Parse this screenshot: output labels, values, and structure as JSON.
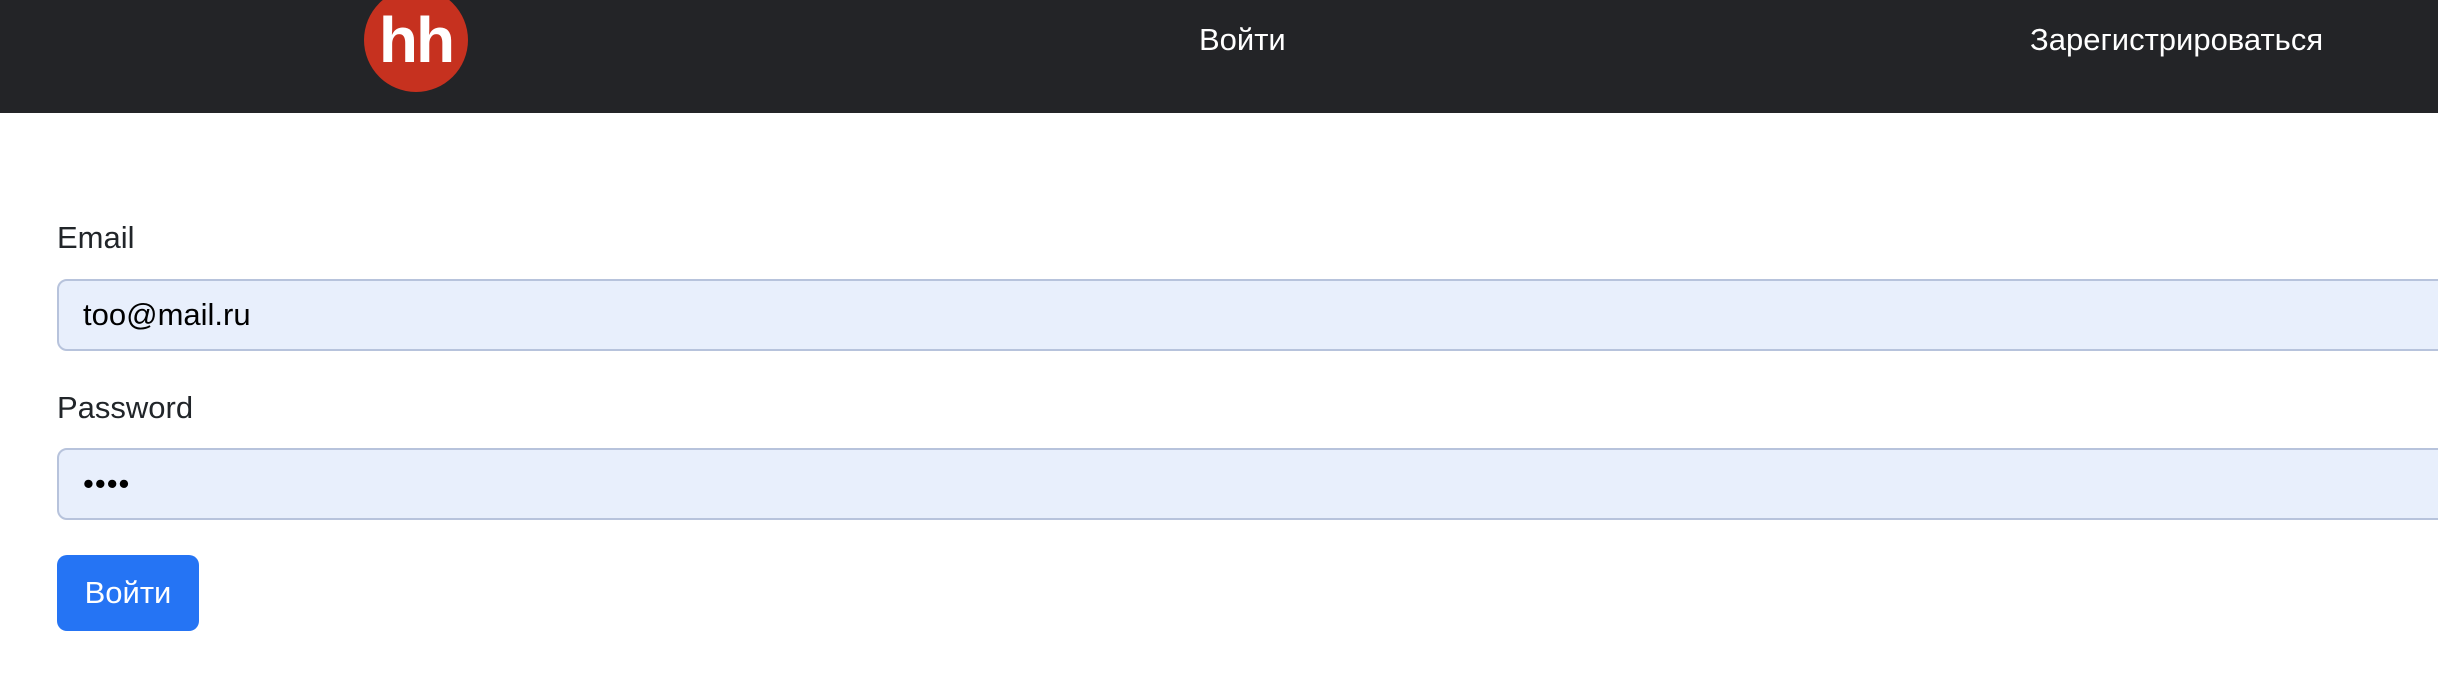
{
  "navbar": {
    "logo_text": "hh",
    "login_link": "Войти",
    "register_link": "Зарегистрироваться"
  },
  "form": {
    "email_label": "Email",
    "email_value": "too@mail.ru",
    "password_label": "Password",
    "password_value": "••••",
    "submit_label": "Войти"
  },
  "colors": {
    "navbar_bg": "#232427",
    "logo_bg": "#c6311f",
    "input_bg": "#e8effc",
    "button_bg": "#2574f4"
  }
}
